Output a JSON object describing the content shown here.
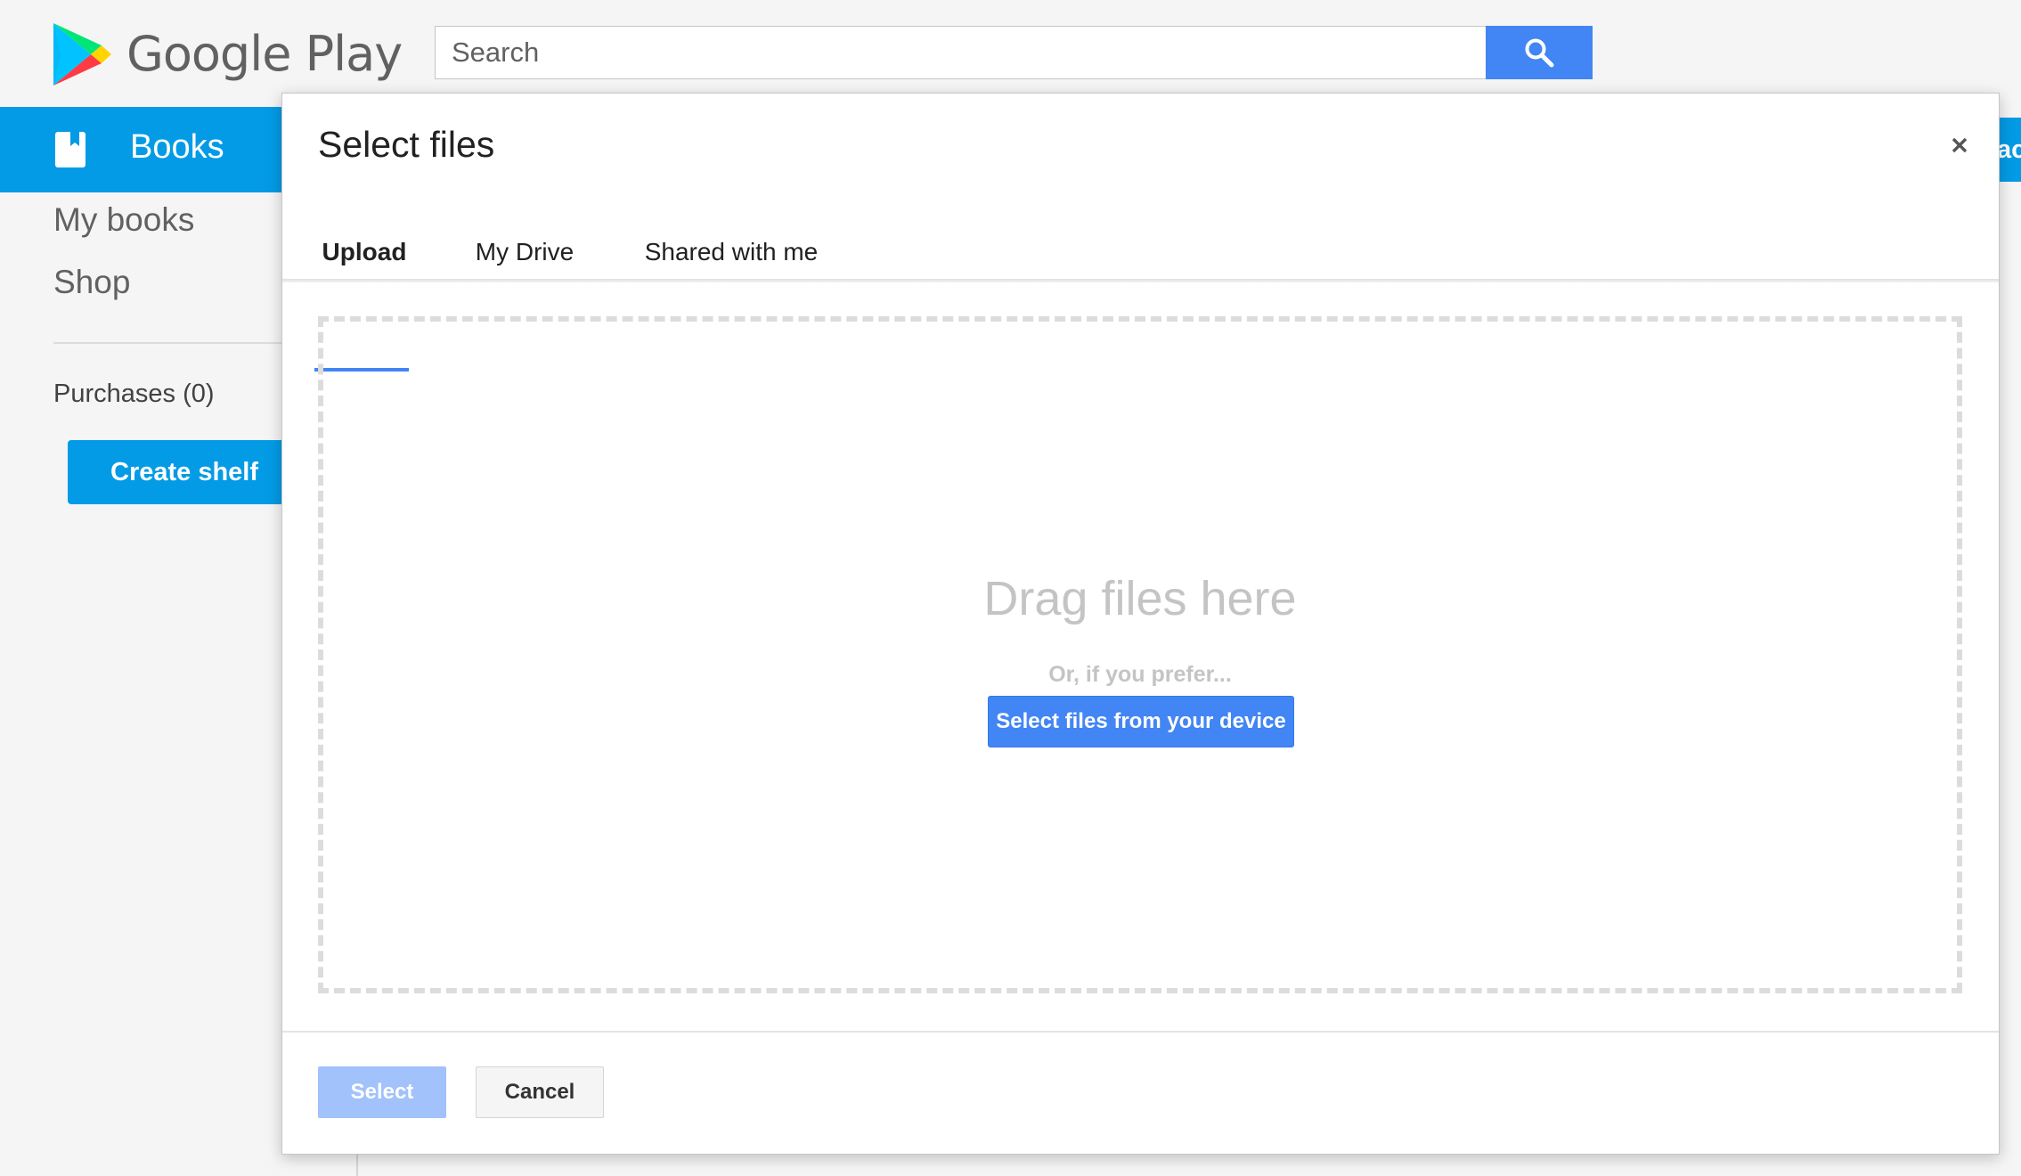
{
  "header": {
    "logo_text": "Google Play",
    "search": {
      "placeholder": "Search",
      "value": ""
    },
    "search_icon": "magnifier-icon"
  },
  "sidebar": {
    "section_label": "Books",
    "section_icon": "book-icon",
    "links": [
      "My books",
      "Shop"
    ],
    "purchases_label": "Purchases (0)",
    "create_shelf_label": "Create shelf",
    "accent_color": "#039be5"
  },
  "dialog": {
    "title": "Select files",
    "close_icon": "close-icon",
    "tabs": [
      {
        "label": "Upload",
        "active": true
      },
      {
        "label": "My Drive",
        "active": false
      },
      {
        "label": "Shared with me",
        "active": false
      }
    ],
    "dropzone": {
      "drag_text": "Drag files here",
      "prefer_text": "Or, if you prefer...",
      "select_button_label": "Select files from your device"
    },
    "footer": {
      "select_label": "Select",
      "cancel_label": "Cancel"
    },
    "accent_color": "#4285f4"
  },
  "background_peek_text": "ac"
}
